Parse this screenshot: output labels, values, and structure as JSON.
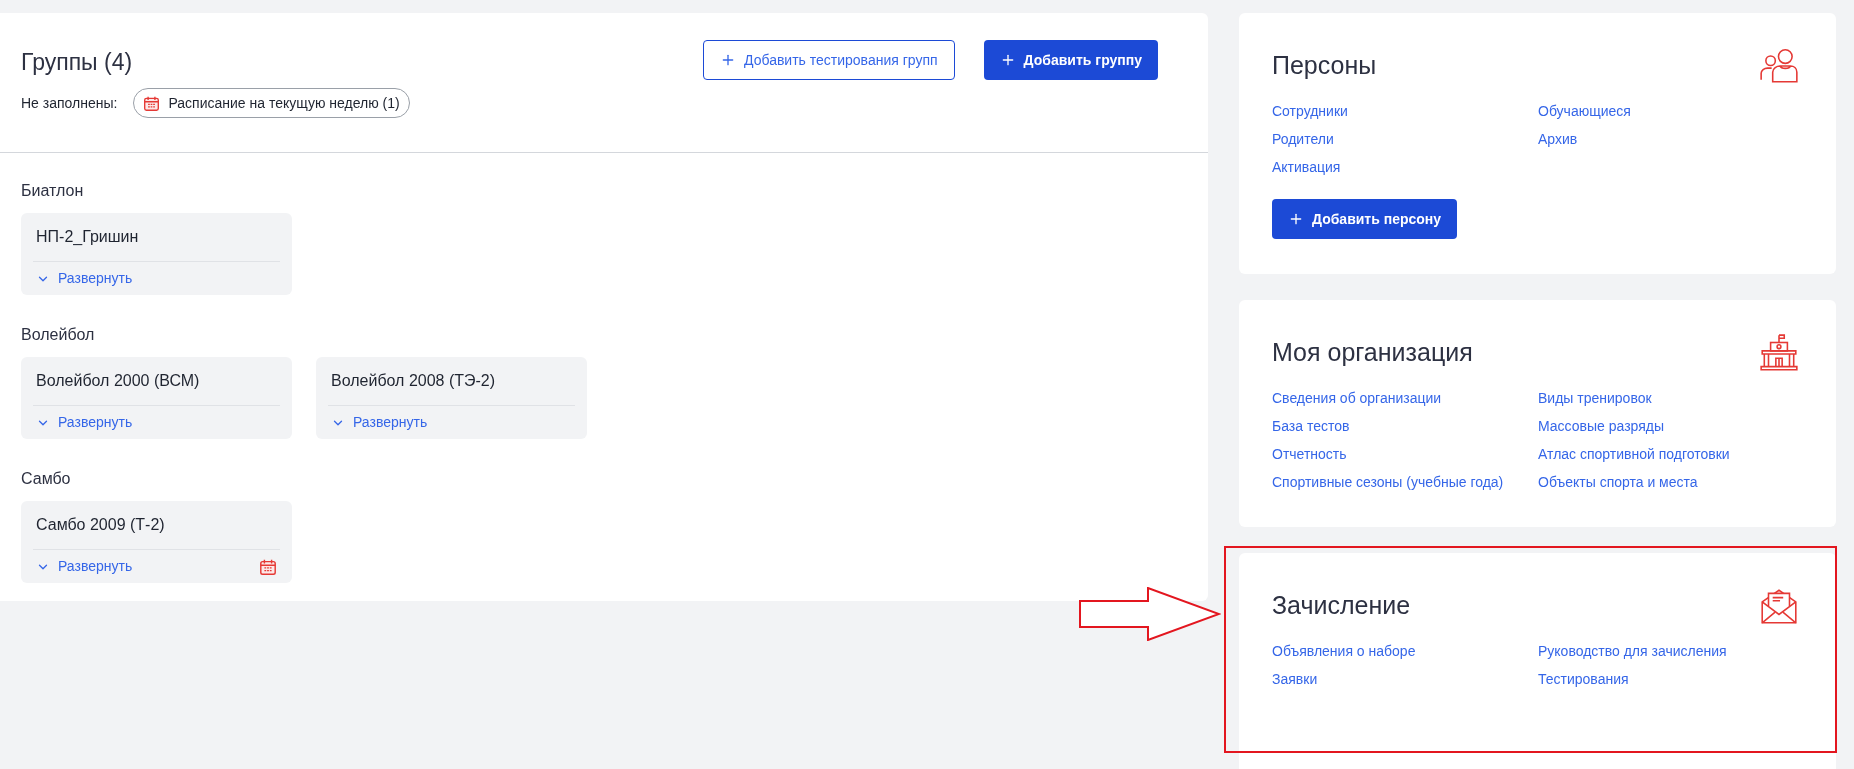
{
  "groups_panel": {
    "title": "Группы (4)",
    "buttons": [
      {
        "label": "Добавить тестирования групп",
        "kind": "outline"
      },
      {
        "label": "Добавить группу",
        "kind": "primary"
      }
    ],
    "unfilled_label": "Не заполнены:",
    "unfilled_chip": "Расписание на текущую неделю (1)",
    "sections": [
      {
        "name": "Биатлон",
        "groups": [
          {
            "name": "НП-2_Гришин",
            "expand": "Развернуть",
            "schedule_missing": false
          }
        ]
      },
      {
        "name": "Волейбол",
        "groups": [
          {
            "name": "Волейбол 2000 (ВСМ)",
            "expand": "Развернуть",
            "schedule_missing": false
          },
          {
            "name": "Волейбол 2008 (ТЭ-2)",
            "expand": "Развернуть",
            "schedule_missing": false
          }
        ]
      },
      {
        "name": "Самбо",
        "groups": [
          {
            "name": "Самбо 2009 (Т-2)",
            "expand": "Развернуть",
            "schedule_missing": true
          }
        ]
      }
    ]
  },
  "cards": [
    {
      "title": "Персоны",
      "kind": "people",
      "links": [
        "Сотрудники",
        "Обучающиеся",
        "Родители",
        "Архив",
        "Активация"
      ],
      "button": "Добавить персону",
      "highlighted": false
    },
    {
      "title": "Моя организация",
      "kind": "building",
      "links": [
        "Сведения об организации",
        "Виды тренировок",
        "База тестов",
        "Массовые разряды",
        "Отчетность",
        "Атлас спортивной подготовки",
        "Спортивные сезоны (учебные года)",
        "Объекты спорта и места"
      ],
      "highlighted": false
    },
    {
      "title": "Зачисление",
      "kind": "envelope",
      "links": [
        "Объявления о наборе",
        "Руководство для зачисления",
        "Заявки",
        "Тестирования"
      ],
      "highlighted": true
    }
  ]
}
